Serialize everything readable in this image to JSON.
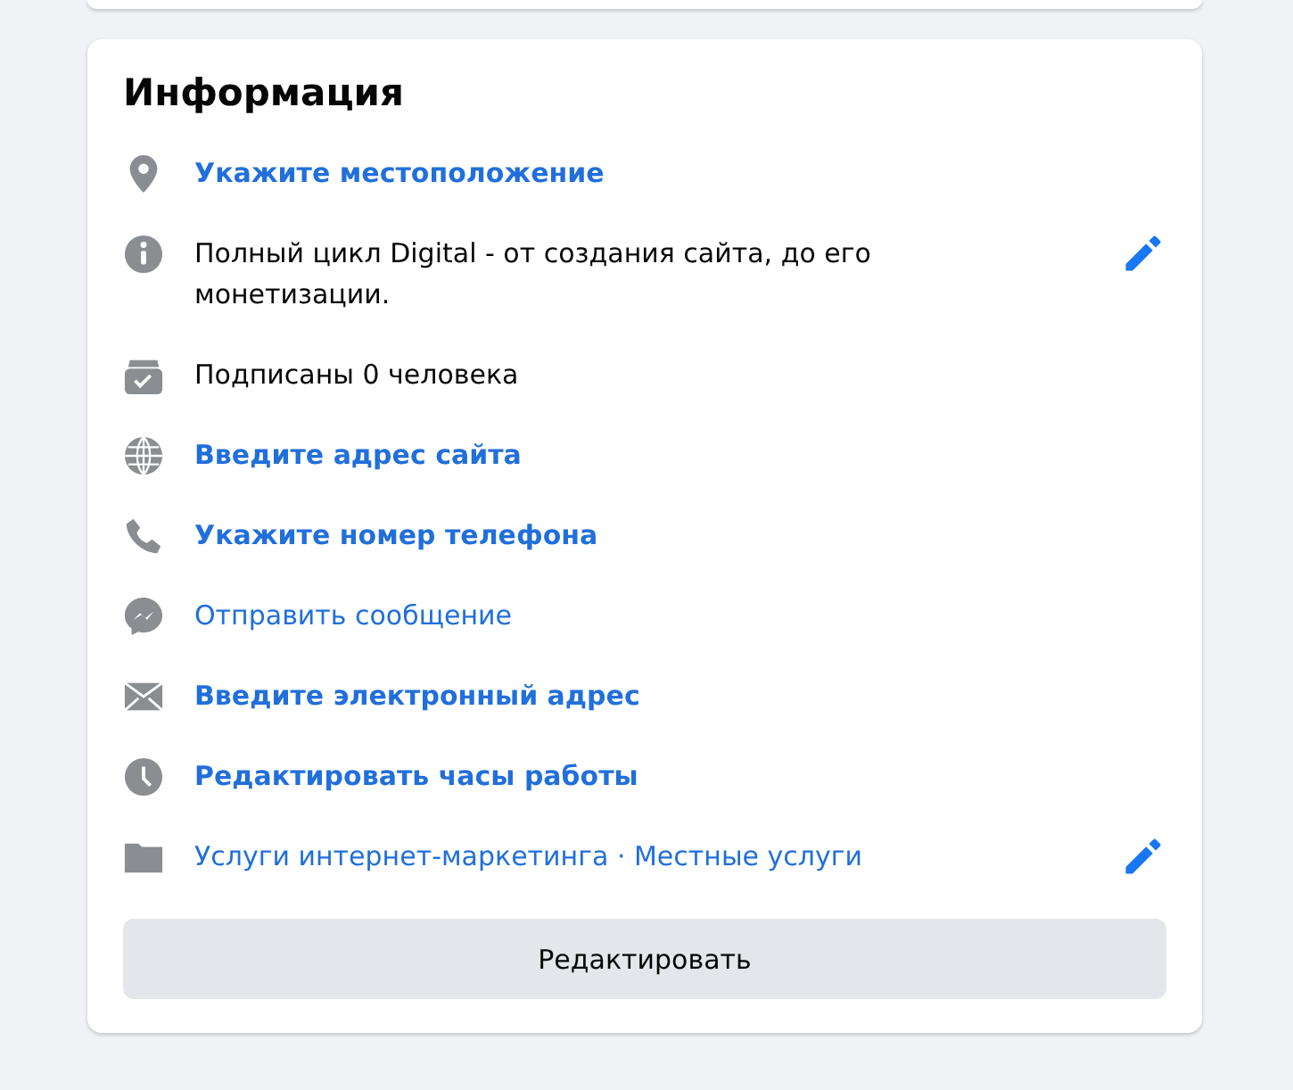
{
  "title": "Информация",
  "rows": [
    {
      "kind": "link",
      "text": "Укажите местоположение",
      "editable": false
    },
    {
      "kind": "text",
      "text": "Полный цикл Digital - от создания сайта, до его монетизации.",
      "editable": true
    },
    {
      "kind": "text",
      "text": "Подписаны 0 человека",
      "editable": false
    },
    {
      "kind": "link",
      "text": "Введите адрес сайта",
      "editable": false
    },
    {
      "kind": "link",
      "text": "Укажите номер телефона",
      "editable": false
    },
    {
      "kind": "plain_link",
      "text": "Отправить сообщение",
      "editable": false
    },
    {
      "kind": "link",
      "text": "Введите электронный адрес",
      "editable": false
    },
    {
      "kind": "link",
      "text": "Редактировать часы работы",
      "editable": false
    },
    {
      "kind": "categories",
      "parts": [
        "Услуги интернет-маркетинга",
        "Местные услуги"
      ],
      "separator": " · ",
      "editable": true
    }
  ],
  "button": "Редактировать"
}
